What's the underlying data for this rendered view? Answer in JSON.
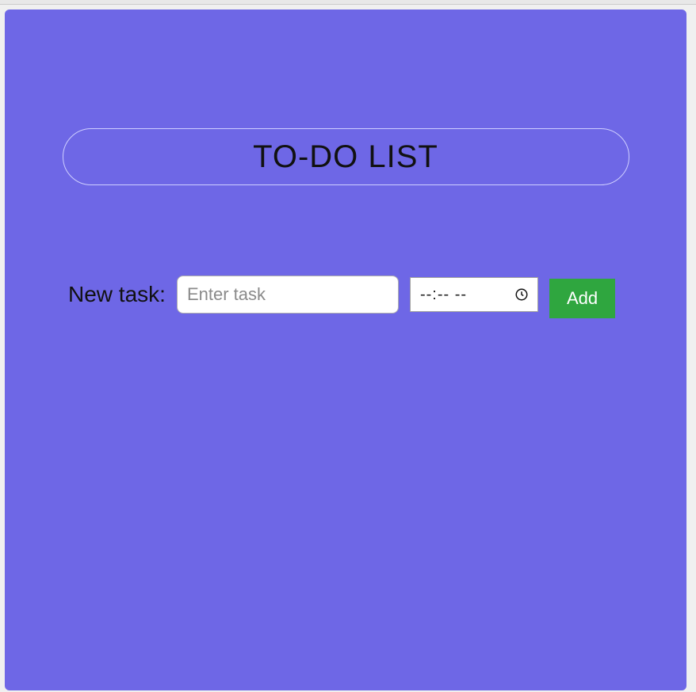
{
  "header": {
    "title": "TO-DO LIST"
  },
  "form": {
    "label": "New task:",
    "task_placeholder": "Enter task",
    "task_value": "",
    "time_placeholder": "--:--  --",
    "add_label": "Add"
  },
  "colors": {
    "background": "#6e67e6",
    "button": "#2fa63f"
  }
}
